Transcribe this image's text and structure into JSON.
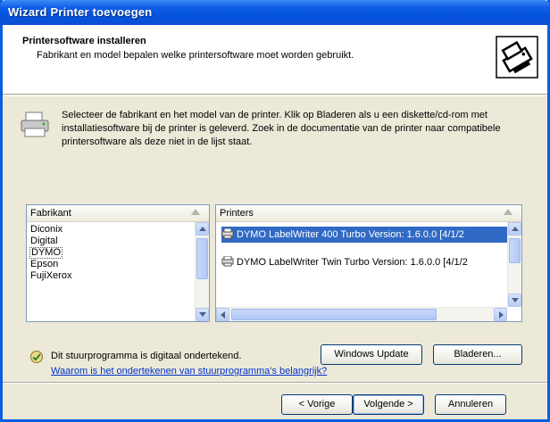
{
  "window": {
    "title": "Wizard Printer toevoegen"
  },
  "header": {
    "title": "Printersoftware installeren",
    "subtitle": "Fabrikant en model bepalen welke printersoftware moet worden gebruikt."
  },
  "intro": {
    "text": "Selecteer de fabrikant en het model van de printer. Klik op Bladeren als u een diskette/cd-rom met installatiesoftware bij de printer is geleverd. Zoek in de documentatie van de printer naar compatibele printersoftware als deze niet in de lijst staat."
  },
  "manufacturers": {
    "header": "Fabrikant",
    "items": [
      "Diconix",
      "Digital",
      "DYMO",
      "Epson",
      "FujiXerox"
    ],
    "selected": "DYMO"
  },
  "printers": {
    "header": "Printers",
    "items": [
      "DYMO LabelWriter 400 Turbo Version: 1.6.0.0 [4/1/2",
      "DYMO LabelWriter Twin Turbo Version: 1.6.0.0 [4/1/2"
    ],
    "selected_index": 0
  },
  "signature": {
    "status": "Dit stuurprogramma is digitaal ondertekend.",
    "link": "Waarom is het ondertekenen van stuurprogramma's belangrijk?"
  },
  "buttons": {
    "windows_update": "Windows Update",
    "browse": "Bladeren...",
    "back": "< Vorige",
    "next": "Volgende >",
    "cancel": "Annuleren"
  },
  "colors": {
    "titlebar": "#0653de",
    "selection": "#316ac5",
    "link": "#0033cc",
    "dialog_bg": "#ece9d8"
  }
}
